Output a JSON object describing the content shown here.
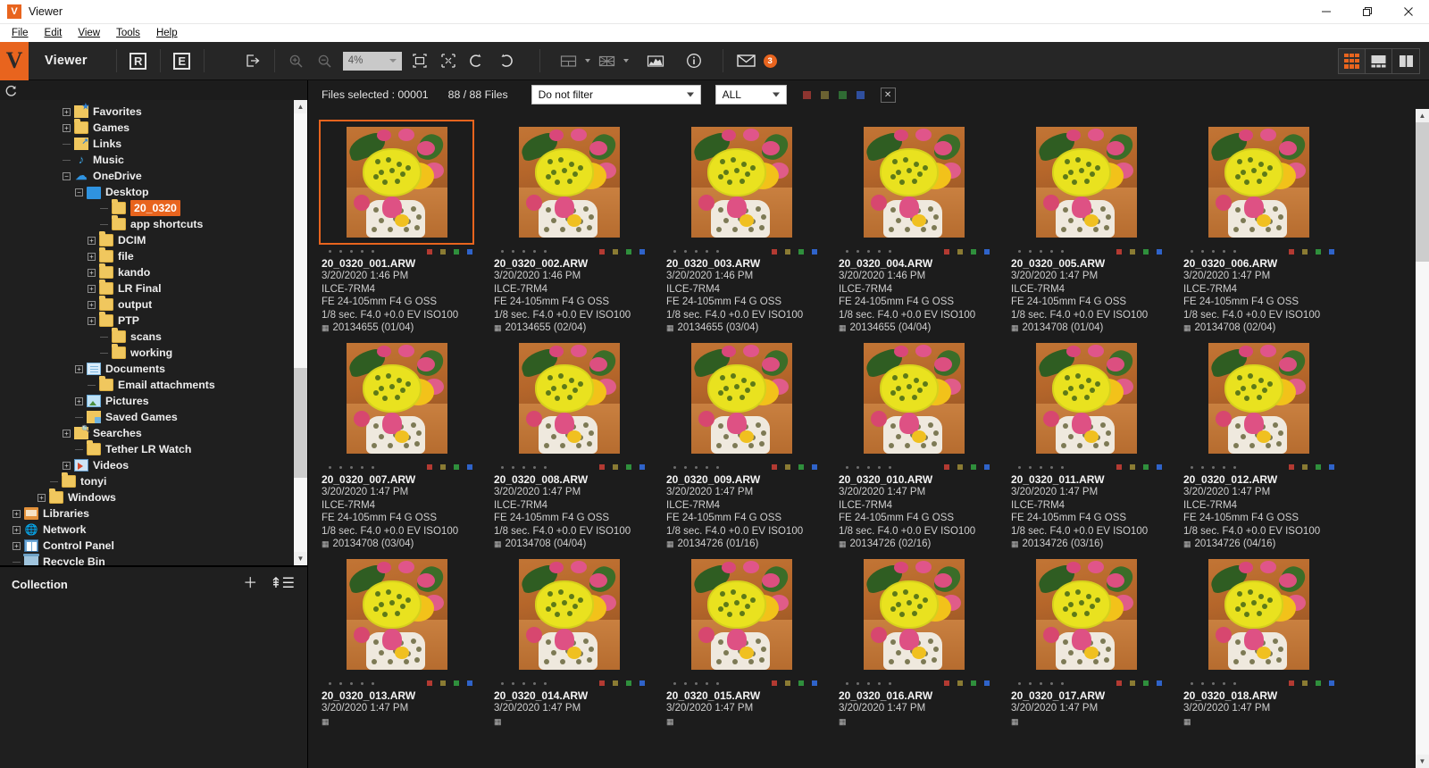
{
  "window": {
    "title": "Viewer",
    "logo_letter": "V",
    "controls": [
      {
        "name": "minimize",
        "label": "—"
      },
      {
        "name": "maximize",
        "label": "❐"
      },
      {
        "name": "close",
        "label": "✕"
      }
    ]
  },
  "menubar": {
    "items": [
      "File",
      "Edit",
      "View",
      "Tools",
      "Help"
    ]
  },
  "toolbar": {
    "brand": "Viewer",
    "logo_letter": "V",
    "raw_button": "R",
    "export_button": "E",
    "zoom_value": "4%",
    "mail_badge": "3",
    "icons": [
      "open-external-icon",
      "zoom-in-icon",
      "zoom-out-icon",
      "fit-to-window-icon",
      "actual-size-icon",
      "rotate-left-icon",
      "rotate-right-icon",
      "layout-icon",
      "compare-icon",
      "histogram-icon",
      "info-icon",
      "mail-icon"
    ],
    "view_modes": [
      "grid-view",
      "filmstrip-view",
      "split-view"
    ],
    "accent_color": "#e8641e"
  },
  "sidebar": {
    "refresh_icon": "refresh-icon",
    "tree": [
      {
        "label": "Favorites",
        "indent": 5,
        "expander": "+",
        "icon": "fav",
        "selected": false
      },
      {
        "label": "Games",
        "indent": 5,
        "expander": "+",
        "icon": "folder",
        "selected": false
      },
      {
        "label": "Links",
        "indent": 5,
        "expander": "",
        "icon": "link",
        "selected": false
      },
      {
        "label": "Music",
        "indent": 5,
        "expander": "",
        "icon": "music",
        "selected": false
      },
      {
        "label": "OneDrive",
        "indent": 5,
        "expander": "−",
        "icon": "cloud",
        "selected": false
      },
      {
        "label": "Desktop",
        "indent": 6,
        "expander": "−",
        "icon": "desktop",
        "selected": false
      },
      {
        "label": "20_0320",
        "indent": 8,
        "expander": "",
        "icon": "folder",
        "selected": true
      },
      {
        "label": "app shortcuts",
        "indent": 8,
        "expander": "",
        "icon": "folder",
        "selected": false
      },
      {
        "label": "DCIM",
        "indent": 7,
        "expander": "+",
        "icon": "folder",
        "selected": false
      },
      {
        "label": "file",
        "indent": 7,
        "expander": "+",
        "icon": "folder",
        "selected": false
      },
      {
        "label": "kando",
        "indent": 7,
        "expander": "+",
        "icon": "folder",
        "selected": false
      },
      {
        "label": "LR Final",
        "indent": 7,
        "expander": "+",
        "icon": "folder",
        "selected": false
      },
      {
        "label": "output",
        "indent": 7,
        "expander": "+",
        "icon": "folder",
        "selected": false
      },
      {
        "label": "PTP",
        "indent": 7,
        "expander": "+",
        "icon": "folder",
        "selected": false
      },
      {
        "label": "scans",
        "indent": 8,
        "expander": "",
        "icon": "folder",
        "selected": false
      },
      {
        "label": "working",
        "indent": 8,
        "expander": "",
        "icon": "folder",
        "selected": false
      },
      {
        "label": "Documents",
        "indent": 6,
        "expander": "+",
        "icon": "doc",
        "selected": false
      },
      {
        "label": "Email attachments",
        "indent": 7,
        "expander": "",
        "icon": "folder",
        "selected": false
      },
      {
        "label": "Pictures",
        "indent": 6,
        "expander": "+",
        "icon": "pic",
        "selected": false
      },
      {
        "label": "Saved Games",
        "indent": 6,
        "expander": "",
        "icon": "saved",
        "selected": false
      },
      {
        "label": "Searches",
        "indent": 5,
        "expander": "+",
        "icon": "search",
        "selected": false
      },
      {
        "label": "Tether LR Watch",
        "indent": 6,
        "expander": "",
        "icon": "folder",
        "selected": false
      },
      {
        "label": "Videos",
        "indent": 5,
        "expander": "+",
        "icon": "video",
        "selected": false
      },
      {
        "label": "tonyi",
        "indent": 4,
        "expander": "",
        "icon": "folder",
        "selected": false
      },
      {
        "label": "Windows",
        "indent": 3,
        "expander": "+",
        "icon": "folder",
        "selected": false
      },
      {
        "label": "Libraries",
        "indent": 1,
        "expander": "+",
        "icon": "lib",
        "selected": false
      },
      {
        "label": "Network",
        "indent": 1,
        "expander": "+",
        "icon": "net",
        "selected": false
      },
      {
        "label": "Control Panel",
        "indent": 1,
        "expander": "+",
        "icon": "cp",
        "selected": false
      },
      {
        "label": "Recycle Bin",
        "indent": 1,
        "expander": "",
        "icon": "bin",
        "selected": false
      }
    ]
  },
  "collection": {
    "title": "Collection",
    "add_icon": "plus-icon",
    "sort_icon": "sort-list-icon"
  },
  "filterbar": {
    "files_selected": "Files selected : 00001",
    "files_count": "88 / 88 Files",
    "filter_select": {
      "value": "Do not filter"
    },
    "label_select": {
      "value": "ALL"
    },
    "color_chips": [
      "#8d3530",
      "#6b6232",
      "#2f6b33",
      "#2f4f9e"
    ],
    "clear_label": "✕"
  },
  "grid": {
    "thumbnails": [
      {
        "name": "20_0320_001.ARW",
        "datetime": "3/20/2020 1:46 PM",
        "camera": "ILCE-7RM4",
        "lens": "FE 24-105mm F4 G OSS",
        "exposure": "1/8 sec. F4.0 +0.0 EV ISO100",
        "group": "20134655 (01/04)",
        "selected": true
      },
      {
        "name": "20_0320_002.ARW",
        "datetime": "3/20/2020 1:46 PM",
        "camera": "ILCE-7RM4",
        "lens": "FE 24-105mm F4 G OSS",
        "exposure": "1/8 sec. F4.0 +0.0 EV ISO100",
        "group": "20134655 (02/04)",
        "selected": false
      },
      {
        "name": "20_0320_003.ARW",
        "datetime": "3/20/2020 1:46 PM",
        "camera": "ILCE-7RM4",
        "lens": "FE 24-105mm F4 G OSS",
        "exposure": "1/8 sec. F4.0 +0.0 EV ISO100",
        "group": "20134655 (03/04)",
        "selected": false
      },
      {
        "name": "20_0320_004.ARW",
        "datetime": "3/20/2020 1:46 PM",
        "camera": "ILCE-7RM4",
        "lens": "FE 24-105mm F4 G OSS",
        "exposure": "1/8 sec. F4.0 +0.0 EV ISO100",
        "group": "20134655 (04/04)",
        "selected": false
      },
      {
        "name": "20_0320_005.ARW",
        "datetime": "3/20/2020 1:47 PM",
        "camera": "ILCE-7RM4",
        "lens": "FE 24-105mm F4 G OSS",
        "exposure": "1/8 sec. F4.0 +0.0 EV ISO100",
        "group": "20134708 (01/04)",
        "selected": false
      },
      {
        "name": "20_0320_006.ARW",
        "datetime": "3/20/2020 1:47 PM",
        "camera": "ILCE-7RM4",
        "lens": "FE 24-105mm F4 G OSS",
        "exposure": "1/8 sec. F4.0 +0.0 EV ISO100",
        "group": "20134708 (02/04)",
        "selected": false
      },
      {
        "name": "20_0320_007.ARW",
        "datetime": "3/20/2020 1:47 PM",
        "camera": "ILCE-7RM4",
        "lens": "FE 24-105mm F4 G OSS",
        "exposure": "1/8 sec. F4.0 +0.0 EV ISO100",
        "group": "20134708 (03/04)",
        "selected": false
      },
      {
        "name": "20_0320_008.ARW",
        "datetime": "3/20/2020 1:47 PM",
        "camera": "ILCE-7RM4",
        "lens": "FE 24-105mm F4 G OSS",
        "exposure": "1/8 sec. F4.0 +0.0 EV ISO100",
        "group": "20134708 (04/04)",
        "selected": false
      },
      {
        "name": "20_0320_009.ARW",
        "datetime": "3/20/2020 1:47 PM",
        "camera": "ILCE-7RM4",
        "lens": "FE 24-105mm F4 G OSS",
        "exposure": "1/8 sec. F4.0 +0.0 EV ISO100",
        "group": "20134726 (01/16)",
        "selected": false
      },
      {
        "name": "20_0320_010.ARW",
        "datetime": "3/20/2020 1:47 PM",
        "camera": "ILCE-7RM4",
        "lens": "FE 24-105mm F4 G OSS",
        "exposure": "1/8 sec. F4.0 +0.0 EV ISO100",
        "group": "20134726 (02/16)",
        "selected": false
      },
      {
        "name": "20_0320_011.ARW",
        "datetime": "3/20/2020 1:47 PM",
        "camera": "ILCE-7RM4",
        "lens": "FE 24-105mm F4 G OSS",
        "exposure": "1/8 sec. F4.0 +0.0 EV ISO100",
        "group": "20134726 (03/16)",
        "selected": false
      },
      {
        "name": "20_0320_012.ARW",
        "datetime": "3/20/2020 1:47 PM",
        "camera": "ILCE-7RM4",
        "lens": "FE 24-105mm F4 G OSS",
        "exposure": "1/8 sec. F4.0 +0.0 EV ISO100",
        "group": "20134726 (04/16)",
        "selected": false
      },
      {
        "name": "20_0320_013.ARW",
        "datetime": "3/20/2020 1:47 PM",
        "camera": "",
        "lens": "",
        "exposure": "",
        "group": "",
        "selected": false
      },
      {
        "name": "20_0320_014.ARW",
        "datetime": "3/20/2020 1:47 PM",
        "camera": "",
        "lens": "",
        "exposure": "",
        "group": "",
        "selected": false
      },
      {
        "name": "20_0320_015.ARW",
        "datetime": "3/20/2020 1:47 PM",
        "camera": "",
        "lens": "",
        "exposure": "",
        "group": "",
        "selected": false
      },
      {
        "name": "20_0320_016.ARW",
        "datetime": "3/20/2020 1:47 PM",
        "camera": "",
        "lens": "",
        "exposure": "",
        "group": "",
        "selected": false
      },
      {
        "name": "20_0320_017.ARW",
        "datetime": "3/20/2020 1:47 PM",
        "camera": "",
        "lens": "",
        "exposure": "",
        "group": "",
        "selected": false
      },
      {
        "name": "20_0320_018.ARW",
        "datetime": "3/20/2020 1:47 PM",
        "camera": "",
        "lens": "",
        "exposure": "",
        "group": "",
        "selected": false
      }
    ],
    "label_colors": [
      "#b33a32",
      "#8a7b33",
      "#2f8f3c",
      "#2f63c9"
    ],
    "rating_dot_count": 5
  }
}
